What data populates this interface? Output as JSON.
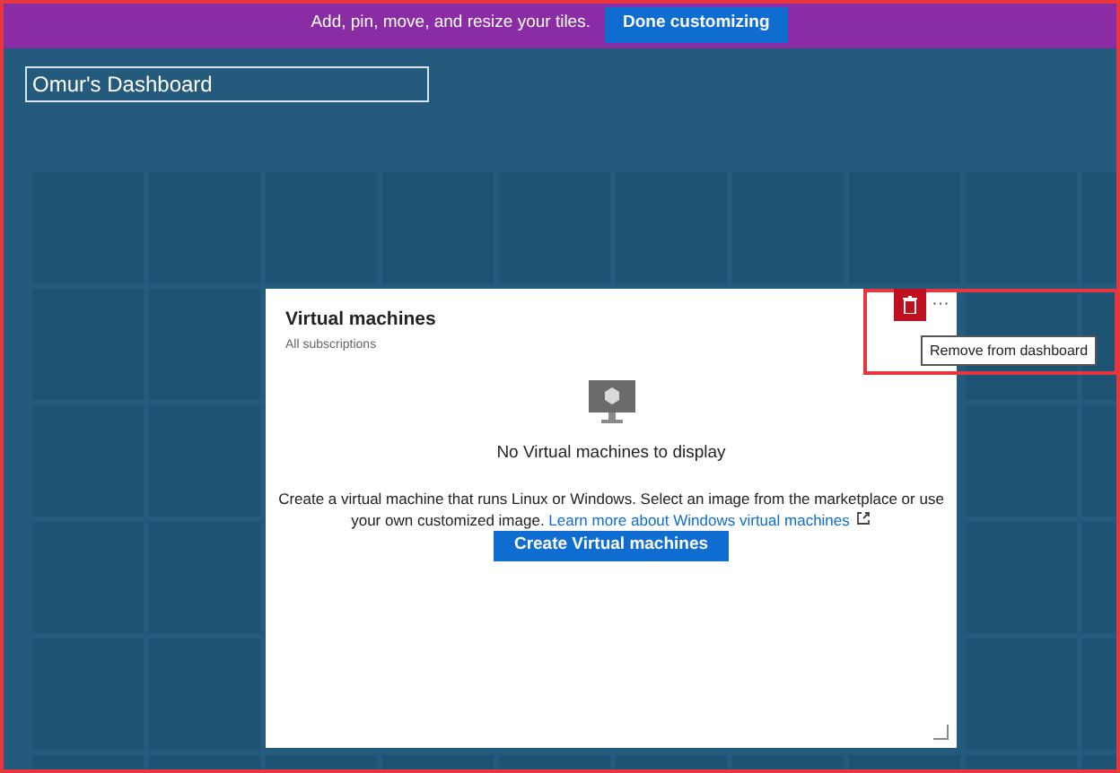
{
  "banner": {
    "text": "Add, pin, move, and resize your tiles.",
    "button": "Done customizing"
  },
  "dashboard_title": "Omur's Dashboard",
  "tile": {
    "title": "Virtual machines",
    "subtitle": "All subscriptions",
    "empty_message": "No Virtual machines to display",
    "description": "Create a virtual machine that runs Linux or Windows. Select an image from the marketplace or use your own customized image.",
    "link": "Learn more about Windows virtual machines",
    "button": "Create Virtual machines",
    "more": "···",
    "tooltip": "Remove from dashboard"
  }
}
